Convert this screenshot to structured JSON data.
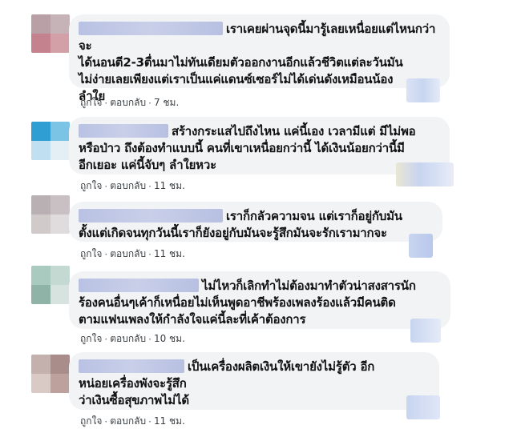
{
  "comments": [
    {
      "text": "เราเคยผ่านจุดนี้มารู้เลยเหนื่อยแต่ไหนกว่าจะ\nได้นอนตี2-3ตื่นมาไม่ทันเดียมตัวออกงานอีกแล้วชีวิตแต่ละวันมัน\nไม่ง่ายเลยเพียงแต่เราเป็นแค่แดนซ์เซอร์ไม่ได้เด่นดังเหมือนน้อง\nลำใย",
      "like": "ถูกใจ",
      "reply": "ตอบกลับ",
      "sep": "·",
      "time": "7 ชม."
    },
    {
      "text": "สร้างกระแสไปถึงไหน แค่นี้เอง เวลามีแต่ มีไม่พอ\nหรือป่าว ถึงต้องทำแบบนี้ คนที่เขาเหนื่อยกว่านี้ ได้เงินน้อยกว่านี้มี\nอีกเยอะ แค่นี้จับๆ ลำใยหวะ",
      "like": "ถูกใจ",
      "reply": "ตอบกลับ",
      "sep": "·",
      "time": "11 ชม."
    },
    {
      "text": "เราก็กลัวความจน แต่เราก็อยู่กับมัน\nตั้งแต่เกิดจนทุกวันนี้เราก็ยังอยู่กับมันจะรู้สึกมันจะรักเรามากจะ",
      "like": "ถูกใจ",
      "reply": "ตอบกลับ",
      "sep": "·",
      "time": "11 ชม."
    },
    {
      "text": "ไม่ไหวก็เลิกทำไม่ต้องมาทำตัวน่าสงสารนัก\nร้องคนอื่นๆเค้าก็เหนื่อยไม่เห็นพูดอาชีพร้องเพลงร้องแล้วมีคนติด\nตามแฟนเพลงให้กำลังใจแค่นี้ละที่เค้าต้องการ",
      "like": "ถูกใจ",
      "reply": "ตอบกลับ",
      "sep": "·",
      "time": "10 ชม."
    },
    {
      "text": "เป็นเครื่องผลิตเงินให้เขายังไม่รู้ตัว อีก\nหน่อยเครื่องพังจะรู้สึก\nว่าเงินซื้อสุขภาพไม่ได้",
      "like": "ถูกใจ",
      "reply": "ตอบกลับ",
      "sep": "·",
      "time": "11 ชม."
    }
  ],
  "colors": {
    "bubble": "#f2f3f5",
    "avatar1": [
      "#b8a0a6",
      "#c6b3b7",
      "#c4828f",
      "#d3a0a8"
    ],
    "avatar2": [
      "#2f9ed3",
      "#7cc4e6",
      "#c0dff0",
      "#e3eef5"
    ],
    "avatar3": [
      "#b8b0b2",
      "#c8c0c2",
      "#d1cacb",
      "#e0dbdc"
    ],
    "avatar4": [
      "#a9cbbf",
      "#c4d9d2",
      "#8fb3a7",
      "#d7e3df"
    ],
    "avatar5": [
      "#c4b1ad",
      "#a88d8a",
      "#d9cac6",
      "#bda19d"
    ]
  }
}
